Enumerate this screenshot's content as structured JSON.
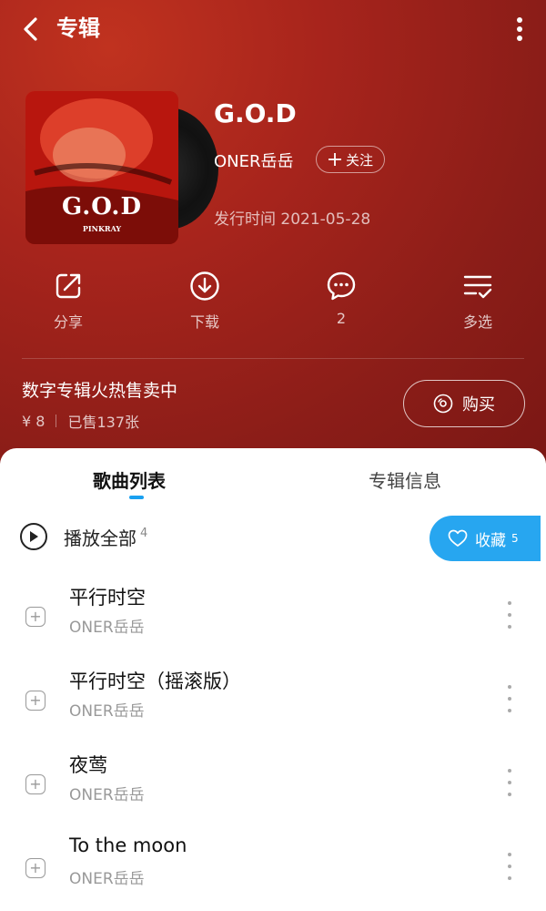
{
  "header": {
    "title": "专辑"
  },
  "album": {
    "cover_title": "G.O.D",
    "cover_subtitle": "PINKRAY",
    "name": "G.O.D",
    "artist": "ONER岳岳",
    "follow_label": "关注",
    "release": "发行时间  2021-05-28"
  },
  "actions": [
    {
      "label": "分享",
      "icon": "share-icon"
    },
    {
      "label": "下载",
      "icon": "download-icon"
    },
    {
      "label": "2",
      "icon": "comment-icon"
    },
    {
      "label": "多选",
      "icon": "multiselect-icon"
    }
  ],
  "promo": {
    "text": "数字专辑火热售卖中",
    "price": "¥ 8",
    "sold": "已售137张",
    "buy_label": "购买"
  },
  "tabs": {
    "songs": "歌曲列表",
    "info": "专辑信息"
  },
  "playall": {
    "label": "播放全部",
    "count": "4"
  },
  "collect": {
    "label": "收藏",
    "count": "5"
  },
  "songs": [
    {
      "title": "平行时空",
      "artist": "ONER岳岳"
    },
    {
      "title": "平行时空（摇滚版）",
      "artist": "ONER岳岳"
    },
    {
      "title": "夜莺",
      "artist": "ONER岳岳"
    },
    {
      "title": "To the moon",
      "artist": "ONER岳岳"
    }
  ],
  "colors": {
    "accent": "#27a6f0",
    "hero": "#a7241c"
  }
}
